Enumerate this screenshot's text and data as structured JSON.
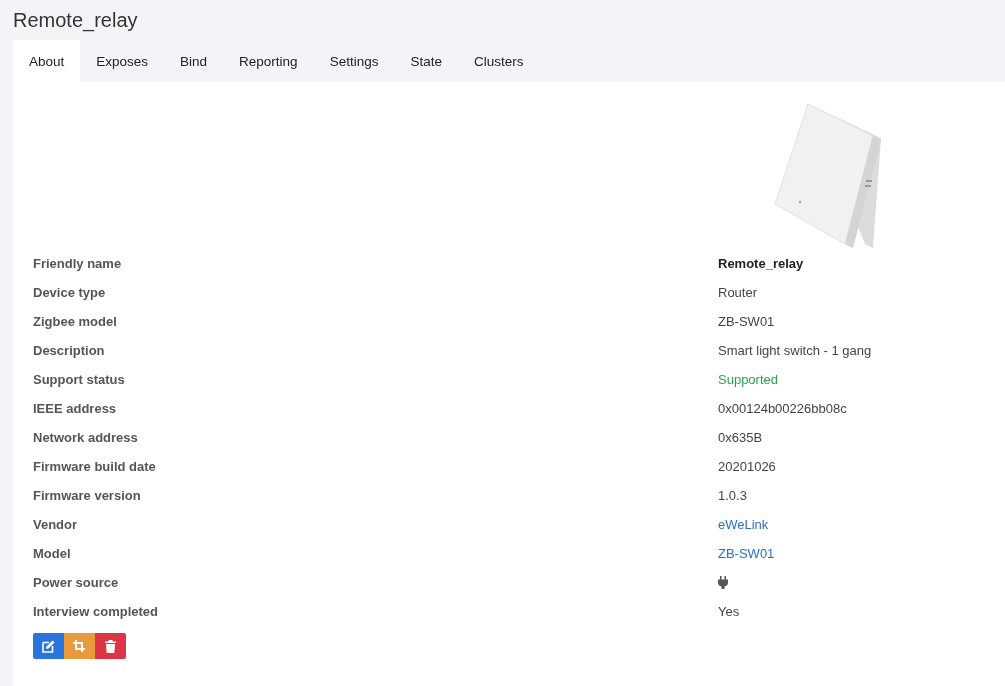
{
  "title": "Remote_relay",
  "tabs": [
    {
      "label": "About",
      "selected": true
    },
    {
      "label": "Exposes",
      "selected": false
    },
    {
      "label": "Bind",
      "selected": false
    },
    {
      "label": "Reporting",
      "selected": false
    },
    {
      "label": "Settings",
      "selected": false
    },
    {
      "label": "State",
      "selected": false
    },
    {
      "label": "Clusters",
      "selected": false
    }
  ],
  "details": [
    {
      "label": "Friendly name",
      "value": "Remote_relay",
      "kind": "bold"
    },
    {
      "label": "Device type",
      "value": "Router",
      "kind": "text"
    },
    {
      "label": "Zigbee model",
      "value": "ZB-SW01",
      "kind": "text"
    },
    {
      "label": "Description",
      "value": "Smart light switch - 1 gang",
      "kind": "text"
    },
    {
      "label": "Support status",
      "value": "Supported",
      "kind": "status"
    },
    {
      "label": "IEEE address",
      "value": "0x00124b00226bb08c",
      "kind": "text"
    },
    {
      "label": "Network address",
      "value": "0x635B",
      "kind": "text"
    },
    {
      "label": "Firmware build date",
      "value": "20201026",
      "kind": "text"
    },
    {
      "label": "Firmware version",
      "value": "1.0.3",
      "kind": "text"
    },
    {
      "label": "Vendor",
      "value": "eWeLink",
      "kind": "link"
    },
    {
      "label": "Model",
      "value": "ZB-SW01",
      "kind": "link"
    },
    {
      "label": "Power source",
      "kind": "plug"
    },
    {
      "label": "Interview completed",
      "value": "Yes",
      "kind": "text"
    }
  ],
  "actions": [
    {
      "kind": "edit"
    },
    {
      "kind": "reconfigure"
    },
    {
      "kind": "delete"
    }
  ]
}
